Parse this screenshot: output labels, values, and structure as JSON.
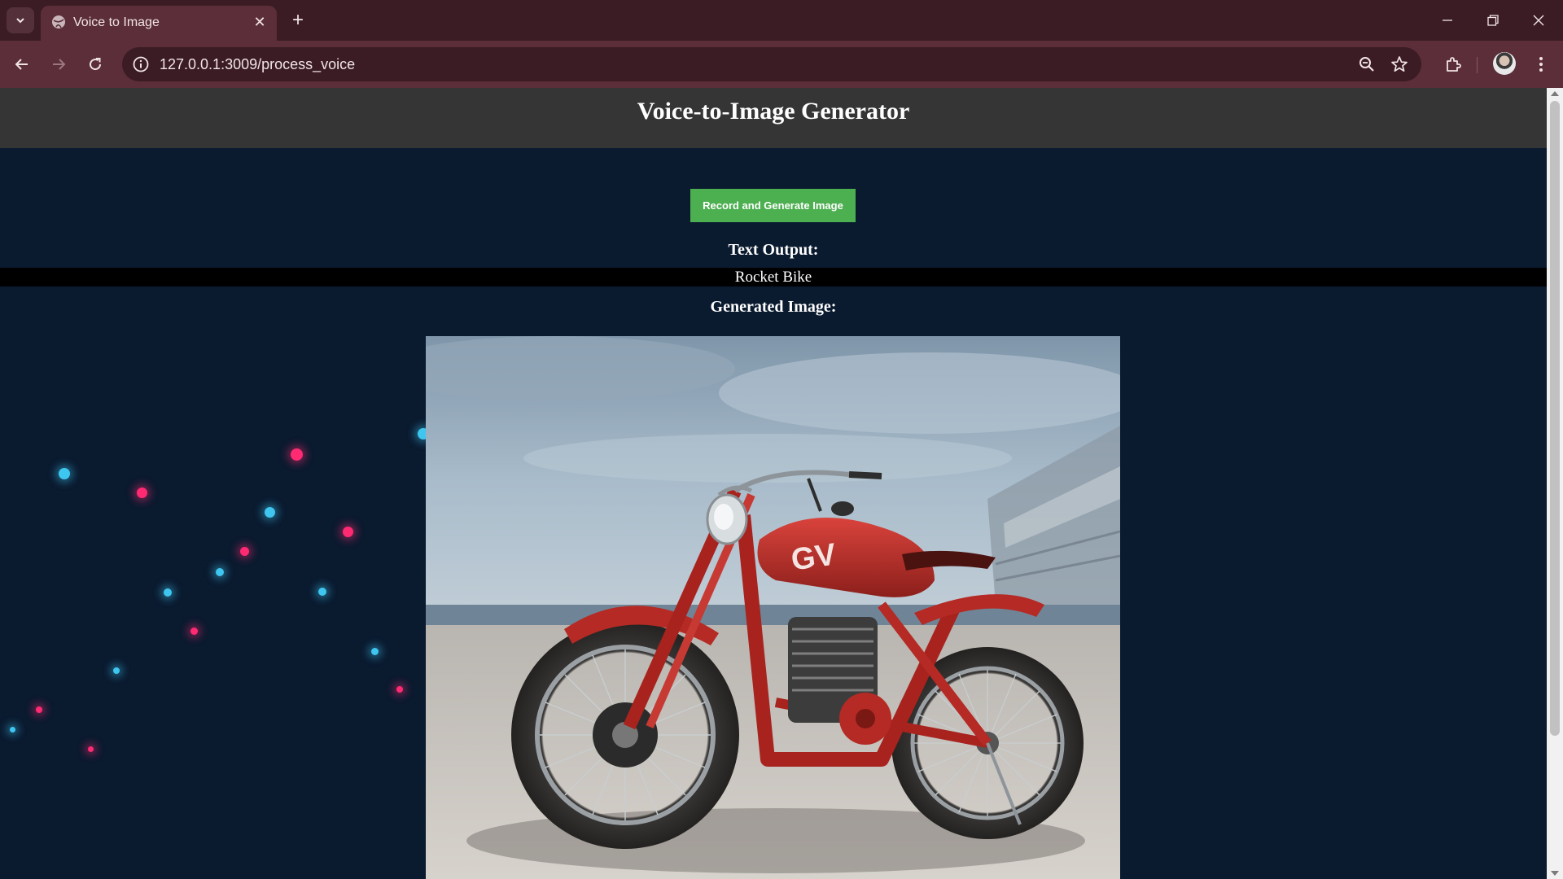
{
  "browser": {
    "tab_title": "Voice to Image",
    "new_tab_symbol": "+",
    "tab_close_symbol": "✕",
    "url": "127.0.0.1:3009/process_voice",
    "icons": [
      "tab-search-icon",
      "globe-icon",
      "close-icon",
      "plus-icon",
      "minimize-icon",
      "restore-icon",
      "window-close-icon",
      "back-icon",
      "forward-icon",
      "reload-icon",
      "info-icon",
      "zoom-icon",
      "star-icon",
      "extensions-icon",
      "profile-avatar",
      "more-menu-icon"
    ]
  },
  "page": {
    "title": "Voice-to-Image Generator",
    "record_button_label": "Record and Generate Image",
    "text_output_label": "Text Output:",
    "text_output_value": "Rocket Bike",
    "generated_image_label": "Generated Image:",
    "generated_image_subject": "red motorcycle on pavement",
    "colors": {
      "header_bg": "#353535",
      "page_bg": "#0a1a2f",
      "button_bg": "#4caf50",
      "dot_blue": "#3ec6f0",
      "dot_pink": "#ff2a72"
    }
  }
}
